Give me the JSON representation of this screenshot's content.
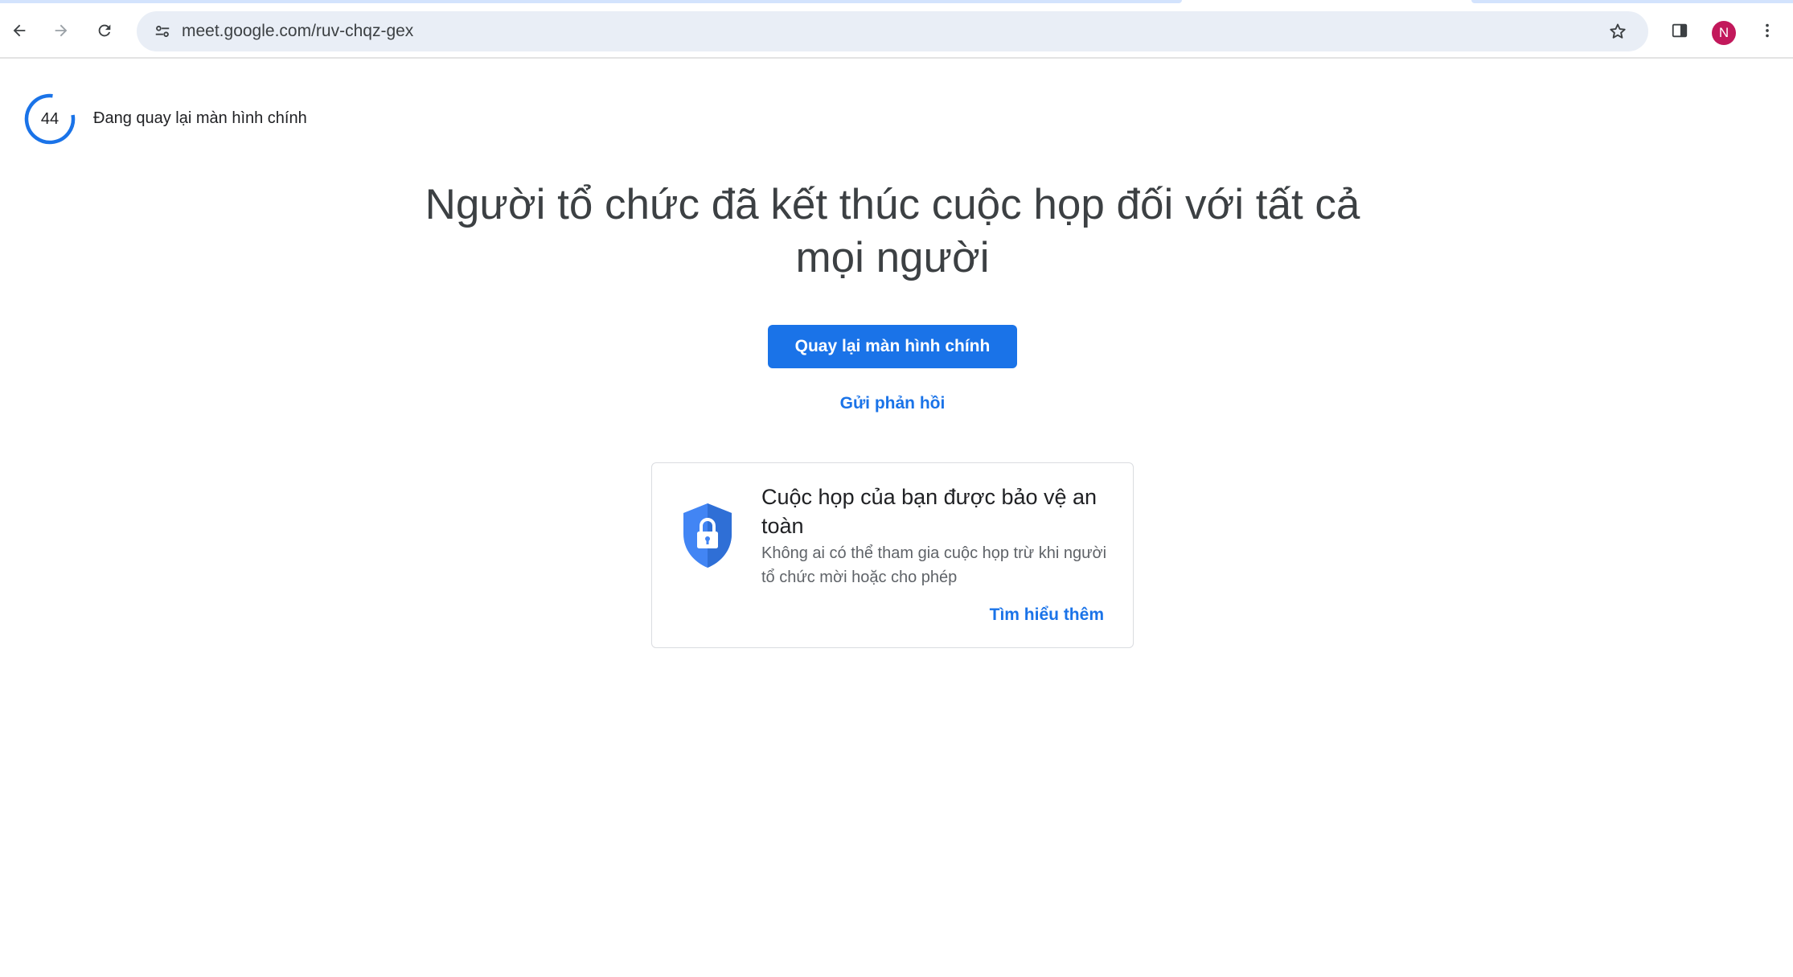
{
  "browser": {
    "url": "meet.google.com/ruv-chqz-gex",
    "profile_initial": "N",
    "accent_color": "#1a73e8",
    "avatar_color": "#c2185b"
  },
  "page": {
    "countdown_value": "44",
    "return_status": "Đang quay lại màn hình chính",
    "title": "Người tổ chức đã kết thúc cuộc họp đối với tất cả mọi người",
    "primary_button": "Quay lại màn hình chính",
    "feedback_link": "Gửi phản hồi",
    "security_card": {
      "title": "Cuộc họp của bạn được bảo vệ an toàn",
      "description": "Không ai có thể tham gia cuộc họp trừ khi người tổ chức mời hoặc cho phép",
      "learn_more": "Tìm hiểu thêm",
      "icon": "shield-lock-icon"
    }
  }
}
